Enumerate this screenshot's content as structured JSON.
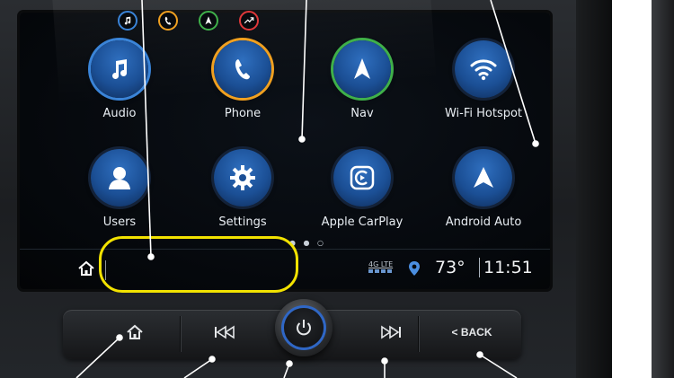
{
  "apps": [
    {
      "label": "Audio",
      "icon": "music-note-icon",
      "ring": "blue"
    },
    {
      "label": "Phone",
      "icon": "phone-icon",
      "ring": "orange"
    },
    {
      "label": "Nav",
      "icon": "navigation-arrow-icon",
      "ring": "green"
    },
    {
      "label": "Wi-Fi Hotspot",
      "icon": "wifi-icon",
      "ring": "none"
    },
    {
      "label": "Users",
      "icon": "user-icon",
      "ring": "none"
    },
    {
      "label": "Settings",
      "icon": "gear-icon",
      "ring": "none"
    },
    {
      "label": "Apple CarPlay",
      "icon": "carplay-icon",
      "ring": "none"
    },
    {
      "label": "Android Auto",
      "icon": "android-auto-icon",
      "ring": "none"
    }
  ],
  "status_bar": {
    "network": "4G LTE",
    "temperature": "73°",
    "time": "11:51",
    "page_dots": "● ● ○"
  },
  "hardware_buttons": {
    "back_label": "< BACK"
  },
  "colors": {
    "highlight_loop": "#f2e200",
    "accent_blue": "#3a84d8",
    "phone_orange": "#f0a020",
    "nav_green": "#3fb04a",
    "recent_red": "#e0383a"
  }
}
